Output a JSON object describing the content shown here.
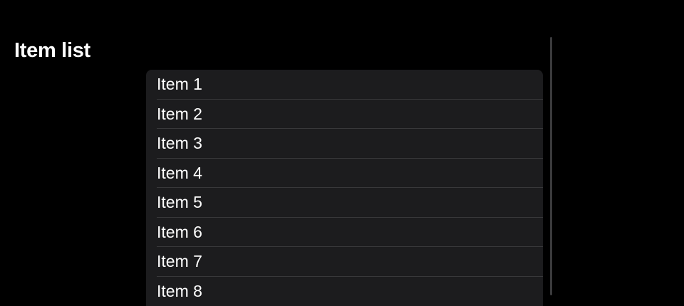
{
  "page": {
    "title": "Item list"
  },
  "list": {
    "items": [
      {
        "label": "Item 1"
      },
      {
        "label": "Item 2"
      },
      {
        "label": "Item 3"
      },
      {
        "label": "Item 4"
      },
      {
        "label": "Item 5"
      },
      {
        "label": "Item 6"
      },
      {
        "label": "Item 7"
      },
      {
        "label": "Item 8"
      }
    ]
  },
  "colors": {
    "background": "#000000",
    "card": "#1c1c1e",
    "separator": "#38383a",
    "text": "#ffffff"
  }
}
